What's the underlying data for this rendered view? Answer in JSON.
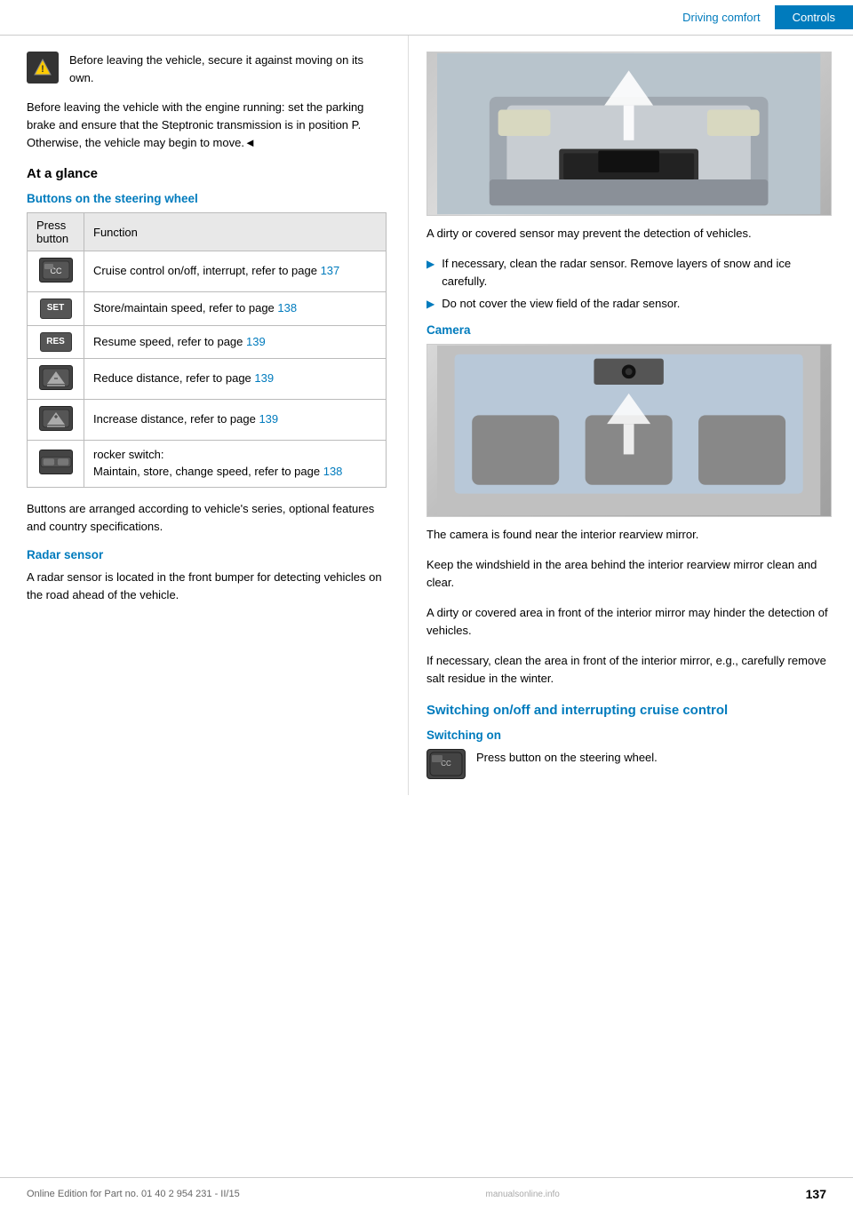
{
  "header": {
    "driving_comfort": "Driving comfort",
    "controls": "Controls"
  },
  "left": {
    "warning_text": "Before leaving the vehicle, secure it against moving on its own.",
    "body_text1": "Before leaving the vehicle with the engine running: set the parking brake and ensure that the Steptronic transmission is in position P. Otherwise, the vehicle may begin to move.◄",
    "at_a_glance_heading": "At a glance",
    "buttons_heading": "Buttons on the steering wheel",
    "table": {
      "col1": "Press button",
      "col2": "Function",
      "rows": [
        {
          "icon_label": "CC",
          "function": "Cruise control on/off, interrupt, refer to page ",
          "page_ref": "137"
        },
        {
          "icon_label": "SET",
          "function": "Store/maintain speed, refer to page ",
          "page_ref": "138"
        },
        {
          "icon_label": "RES",
          "function": "Resume speed, refer to page ",
          "page_ref": "139"
        },
        {
          "icon_label": "▲-",
          "function": "Reduce distance, refer to page ",
          "page_ref": "139"
        },
        {
          "icon_label": "▲+",
          "function": "Increase distance, refer to page ",
          "page_ref": "139"
        },
        {
          "icon_label": "═══",
          "function_line1": "rocker switch:",
          "function_line2": "Maintain, store, change speed, refer to page ",
          "page_ref": "138"
        }
      ]
    },
    "note_text": "Buttons are arranged according to vehicle's series, optional features and country specifications.",
    "radar_heading": "Radar sensor",
    "radar_text": "A radar sensor is located in the front bumper for detecting vehicles on the road ahead of the vehicle."
  },
  "right": {
    "sensor_note": "A dirty or covered sensor may prevent the detection of vehicles.",
    "bullets": [
      "If necessary, clean the radar sensor. Remove layers of snow and ice carefully.",
      "Do not cover the view field of the radar sensor."
    ],
    "camera_heading": "Camera",
    "camera_text1": "The camera is found near the interior rearview mirror.",
    "camera_text2": "Keep the windshield in the area behind the interior rearview mirror clean and clear.",
    "camera_text3": "A dirty or covered area in front of the interior mirror may hinder the detection of vehicles.",
    "camera_text4": "If necessary, clean the area in front of the interior mirror, e.g., carefully remove salt residue in the winter.",
    "switching_heading": "Switching on/off and interrupting cruise control",
    "switching_on_subheading": "Switching on",
    "switching_on_text": "Press button on the steering wheel."
  },
  "footer": {
    "edition": "Online Edition for Part no. 01 40 2 954 231 - II/15",
    "watermark": "manualsonline.info",
    "page": "137"
  }
}
